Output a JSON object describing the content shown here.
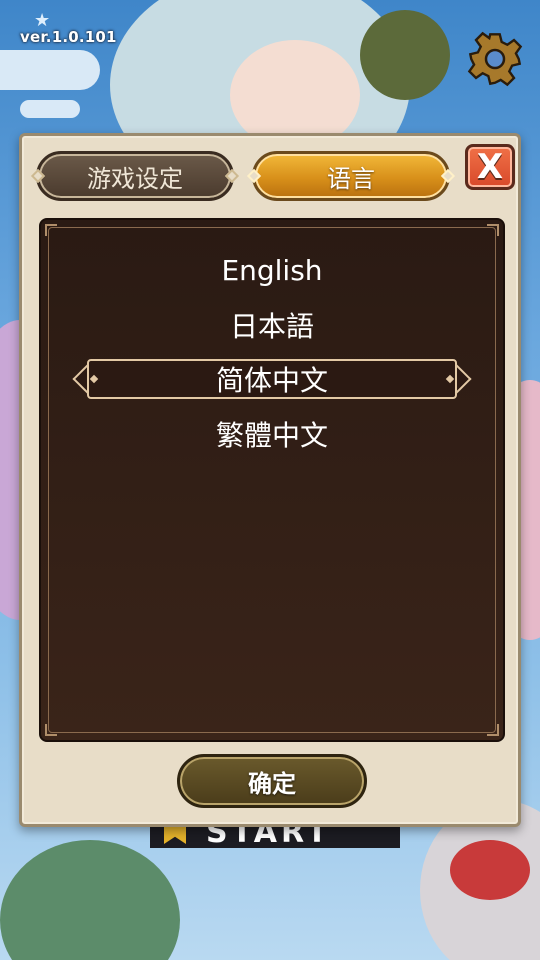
{
  "game": {
    "version": "ver.1.0.101",
    "start_label": "START"
  },
  "settings_dialog": {
    "tabs": [
      {
        "label": "游戏设定",
        "active": false
      },
      {
        "label": "语言",
        "active": true
      }
    ],
    "close_label": "X",
    "languages": [
      {
        "label": "English",
        "selected": false
      },
      {
        "label": "日本語",
        "selected": false
      },
      {
        "label": "简体中文",
        "selected": true
      },
      {
        "label": "繁體中文",
        "selected": false
      }
    ],
    "confirm_label": "确定"
  },
  "icons": {
    "settings": "gear-icon",
    "close": "close-icon",
    "version_star": "star-icon"
  },
  "colors": {
    "accent_gold": "#d8901a",
    "close_red": "#d8492a",
    "panel_dark": "#2a1a13",
    "dialog_bg": "#e8ddc8"
  }
}
